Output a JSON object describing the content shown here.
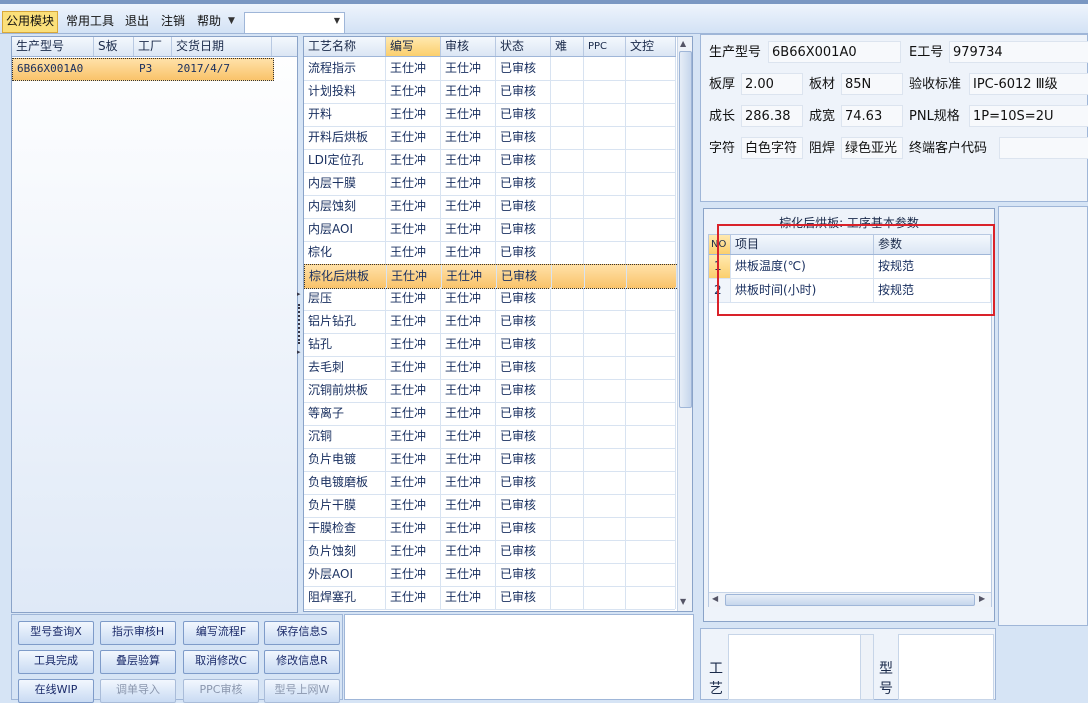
{
  "menu": {
    "items": [
      "公用模块",
      "常用工具",
      "退出",
      "注销",
      "帮助"
    ],
    "combo_value": ""
  },
  "left_grid": {
    "columns": [
      "生产型号",
      "S板",
      "工厂",
      "交货日期"
    ],
    "rows": [
      {
        "model": "6B66X001A0",
        "sboard": "",
        "factory": "P3",
        "date": "2017/4/7"
      }
    ]
  },
  "process_grid": {
    "columns": [
      "工艺名称",
      "编写",
      "审核",
      "状态",
      "难",
      "PPC",
      "文控"
    ],
    "selected_index": 9,
    "rows": [
      {
        "name": "流程指示",
        "writer": "王仕冲",
        "reviewer": "王仕冲",
        "status": "已审核"
      },
      {
        "name": "计划投料",
        "writer": "王仕冲",
        "reviewer": "王仕冲",
        "status": "已审核"
      },
      {
        "name": "开料",
        "writer": "王仕冲",
        "reviewer": "王仕冲",
        "status": "已审核"
      },
      {
        "name": "开料后烘板",
        "writer": "王仕冲",
        "reviewer": "王仕冲",
        "status": "已审核"
      },
      {
        "name": "LDI定位孔",
        "writer": "王仕冲",
        "reviewer": "王仕冲",
        "status": "已审核"
      },
      {
        "name": "内层干膜",
        "writer": "王仕冲",
        "reviewer": "王仕冲",
        "status": "已审核"
      },
      {
        "name": "内层蚀刻",
        "writer": "王仕冲",
        "reviewer": "王仕冲",
        "status": "已审核"
      },
      {
        "name": "内层AOI",
        "writer": "王仕冲",
        "reviewer": "王仕冲",
        "status": "已审核"
      },
      {
        "name": "棕化",
        "writer": "王仕冲",
        "reviewer": "王仕冲",
        "status": "已审核"
      },
      {
        "name": "棕化后烘板",
        "writer": "王仕冲",
        "reviewer": "王仕冲",
        "status": "已审核"
      },
      {
        "name": "层压",
        "writer": "王仕冲",
        "reviewer": "王仕冲",
        "status": "已审核"
      },
      {
        "name": "铝片钻孔",
        "writer": "王仕冲",
        "reviewer": "王仕冲",
        "status": "已审核"
      },
      {
        "name": "钻孔",
        "writer": "王仕冲",
        "reviewer": "王仕冲",
        "status": "已审核"
      },
      {
        "name": "去毛刺",
        "writer": "王仕冲",
        "reviewer": "王仕冲",
        "status": "已审核"
      },
      {
        "name": "沉铜前烘板",
        "writer": "王仕冲",
        "reviewer": "王仕冲",
        "status": "已审核"
      },
      {
        "name": "等离子",
        "writer": "王仕冲",
        "reviewer": "王仕冲",
        "status": "已审核"
      },
      {
        "name": "沉铜",
        "writer": "王仕冲",
        "reviewer": "王仕冲",
        "status": "已审核"
      },
      {
        "name": "负片电镀",
        "writer": "王仕冲",
        "reviewer": "王仕冲",
        "status": "已审核"
      },
      {
        "name": "负电镀磨板",
        "writer": "王仕冲",
        "reviewer": "王仕冲",
        "status": "已审核"
      },
      {
        "name": "负片干膜",
        "writer": "王仕冲",
        "reviewer": "王仕冲",
        "status": "已审核"
      },
      {
        "name": "干膜检查",
        "writer": "王仕冲",
        "reviewer": "王仕冲",
        "status": "已审核"
      },
      {
        "name": "负片蚀刻",
        "writer": "王仕冲",
        "reviewer": "王仕冲",
        "status": "已审核"
      },
      {
        "name": "外层AOI",
        "writer": "王仕冲",
        "reviewer": "王仕冲",
        "status": "已审核"
      },
      {
        "name": "阻焊塞孔",
        "writer": "王仕冲",
        "reviewer": "王仕冲",
        "status": "已审核"
      }
    ]
  },
  "buttons": [
    {
      "label": "型号查询X",
      "enabled": true
    },
    {
      "label": "指示审核H",
      "enabled": true
    },
    {
      "label": "编写流程F",
      "enabled": true
    },
    {
      "label": "保存信息S",
      "enabled": true
    },
    {
      "label": "工具完成",
      "enabled": true
    },
    {
      "label": "叠层验算",
      "enabled": true
    },
    {
      "label": "取消修改C",
      "enabled": true
    },
    {
      "label": "修改信息R",
      "enabled": true
    },
    {
      "label": "在线WIP",
      "enabled": true
    },
    {
      "label": "调单导入",
      "enabled": false
    },
    {
      "label": "PPC审核",
      "enabled": false
    },
    {
      "label": "型号上网W",
      "enabled": false
    }
  ],
  "info": {
    "model_label": "生产型号",
    "model_value": "6B66X001A0",
    "e_label": "E工号",
    "e_value": "979734",
    "thickness_label": "板厚",
    "thickness_value": "2.00",
    "material_label": "板材",
    "material_value": "85N",
    "standard_label": "验收标准",
    "standard_value": "IPC-6012 Ⅲ级",
    "length_label": "成长",
    "length_value": "286.38",
    "width_label": "成宽",
    "width_value": "74.63",
    "pnl_label": "PNL规格",
    "pnl_value": "1P=10S=2U",
    "char_label": "字符",
    "char_value": "白色字符",
    "mask_label": "阻焊",
    "mask_value": "绿色亚光",
    "customer_label": "终端客户代码",
    "customer_value": ""
  },
  "params": {
    "title": "棕化后烘板: 工序基本参数",
    "columns": [
      "NO",
      "项目",
      "参数"
    ],
    "rows": [
      {
        "no": "1",
        "item": "烘板温度(℃)",
        "value": "按规范"
      },
      {
        "no": "2",
        "item": "烘板时间(小时)",
        "value": "按规范"
      }
    ]
  },
  "bottom_labels": {
    "craft": "工艺",
    "model": "型号"
  },
  "colors": {
    "highlight_box": "#d9222a",
    "selected_row": "#f9c36a",
    "menu_active": "#fbe07a"
  }
}
